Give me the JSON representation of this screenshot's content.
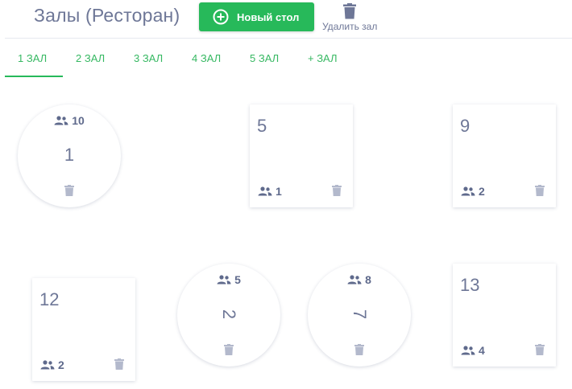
{
  "header": {
    "title": "Залы (Ресторан)",
    "new_table_label": "Новый стол",
    "delete_hall_label": "Удалить зал"
  },
  "tabs": [
    {
      "label": "1 ЗАЛ",
      "active": true
    },
    {
      "label": "2 ЗАЛ",
      "active": false
    },
    {
      "label": "3 ЗАЛ",
      "active": false
    },
    {
      "label": "4 ЗАЛ",
      "active": false
    },
    {
      "label": "5 ЗАЛ",
      "active": false
    },
    {
      "label": "+ ЗАЛ",
      "active": false
    }
  ],
  "tables": [
    {
      "number": "1",
      "seats": "10",
      "shape": "round"
    },
    {
      "number": "5",
      "seats": "1",
      "shape": "square"
    },
    {
      "number": "9",
      "seats": "2",
      "shape": "square"
    },
    {
      "number": "12",
      "seats": "2",
      "shape": "square"
    },
    {
      "number": "2",
      "seats": "5",
      "shape": "round",
      "rotated": true
    },
    {
      "number": "7",
      "seats": "8",
      "shape": "round",
      "rotated": true
    },
    {
      "number": "13",
      "seats": "4",
      "shape": "square"
    }
  ],
  "colors": {
    "accent": "#27b95a",
    "tab_text": "#36b862",
    "title_text": "#6e7797",
    "icon_gray": "#b3b9cc"
  },
  "icons": {
    "new_table": "plus-circle-icon",
    "delete_hall": "trash-icon",
    "seats": "people-icon",
    "delete_table": "trash-icon"
  }
}
